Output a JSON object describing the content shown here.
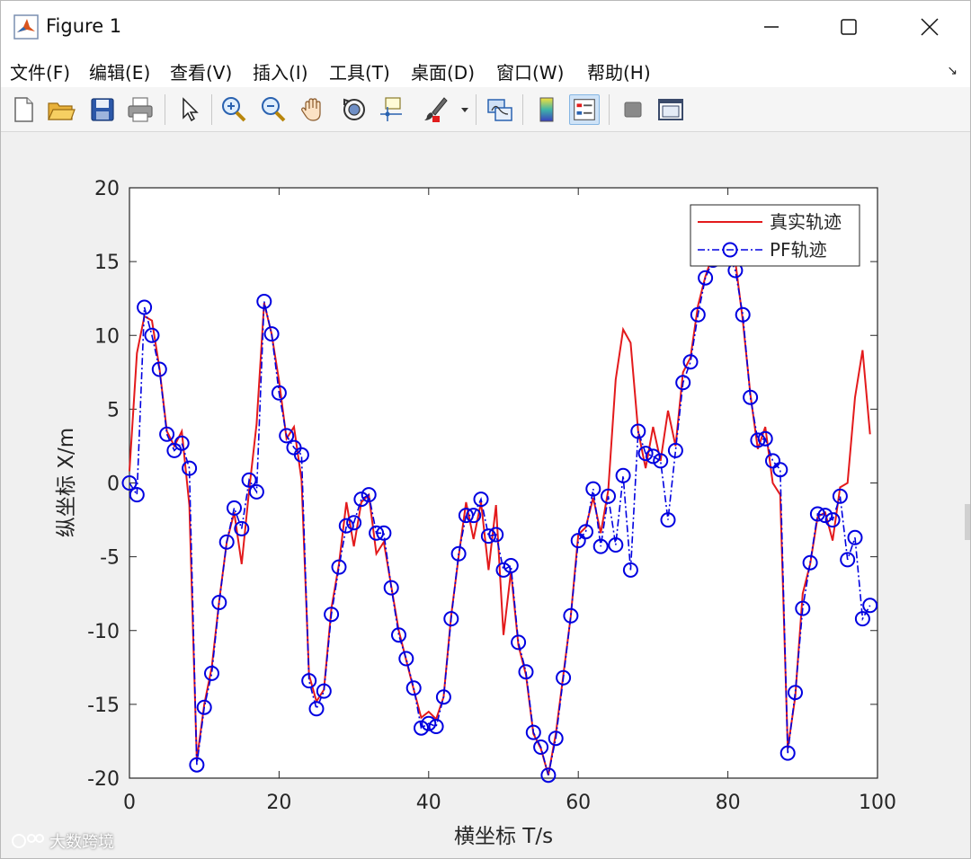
{
  "window": {
    "title": "Figure 1",
    "controls": {
      "minimize": "—",
      "maximize": "☐",
      "close": "✕"
    }
  },
  "menu": {
    "items": [
      "文件(F)",
      "编辑(E)",
      "查看(V)",
      "插入(I)",
      "工具(T)",
      "桌面(D)",
      "窗口(W)",
      "帮助(H)"
    ],
    "overflow_icon": "↘"
  },
  "toolbar": {
    "icons": [
      "new-figure-icon",
      "open-file-icon",
      "save-icon",
      "print-icon",
      "pointer-icon",
      "zoom-in-icon",
      "zoom-out-icon",
      "pan-hand-icon",
      "rotate-3d-icon",
      "data-cursor-icon",
      "brush-icon",
      "brush-dropdown-icon",
      "link-plot-icon",
      "colorbar-icon",
      "legend-icon",
      "hide-plot-tools-icon",
      "show-plot-tools-icon"
    ]
  },
  "watermark": {
    "text": "大数跨境"
  },
  "chart_data": {
    "type": "line",
    "title": "",
    "xlabel": "横坐标 T/s",
    "ylabel": "纵坐标 X/m",
    "xlim": [
      0,
      100
    ],
    "ylim": [
      -20,
      20
    ],
    "xticks": [
      0,
      20,
      40,
      60,
      80,
      100
    ],
    "yticks": [
      -20,
      -15,
      -10,
      -5,
      0,
      5,
      10,
      15,
      20
    ],
    "grid": false,
    "legend_position": "top-right",
    "series": [
      {
        "name": "真实轨迹",
        "color": "#e31a1c",
        "style": "solid",
        "marker": "none",
        "x": [
          0,
          1,
          2,
          3,
          4,
          5,
          6,
          7,
          8,
          9,
          10,
          11,
          12,
          13,
          14,
          15,
          16,
          17,
          18,
          19,
          20,
          21,
          22,
          23,
          24,
          25,
          26,
          27,
          28,
          29,
          30,
          31,
          32,
          33,
          34,
          35,
          36,
          37,
          38,
          39,
          40,
          41,
          42,
          43,
          44,
          45,
          46,
          47,
          48,
          49,
          50,
          51,
          52,
          53,
          54,
          55,
          56,
          57,
          58,
          59,
          60,
          61,
          62,
          63,
          64,
          65,
          66,
          67,
          68,
          69,
          70,
          71,
          72,
          73,
          74,
          75,
          76,
          77,
          78,
          79,
          80,
          81,
          82,
          83,
          84,
          85,
          86,
          87,
          88,
          89,
          90,
          91,
          92,
          93,
          94,
          95,
          96,
          97,
          98,
          99
        ],
        "y": [
          0.8,
          8.8,
          11.3,
          11.0,
          7.8,
          3.5,
          2.5,
          3.5,
          -1.5,
          -18.8,
          -15.0,
          -12.5,
          -8.0,
          -4.0,
          -2.0,
          -5.5,
          -0.5,
          4.0,
          12.2,
          10.1,
          6.9,
          3.0,
          3.8,
          0.2,
          -13.0,
          -14.8,
          -14.0,
          -8.5,
          -5.5,
          -1.3,
          -4.3,
          -1.3,
          -0.8,
          -4.8,
          -4.0,
          -7.0,
          -10.0,
          -12.0,
          -14.0,
          -15.9,
          -15.5,
          -16.0,
          -14.5,
          -9.0,
          -5.0,
          -1.3,
          -3.8,
          -1.3,
          -5.9,
          -1.5,
          -10.3,
          -6.0,
          -11.0,
          -13.0,
          -17.0,
          -18.0,
          -19.8,
          -17.0,
          -13.0,
          -9.0,
          -3.5,
          -3.0,
          -1.0,
          -3.4,
          -0.5,
          7.0,
          10.4,
          9.5,
          3.5,
          1.0,
          3.8,
          1.5,
          4.9,
          2.5,
          7.5,
          8.5,
          12.0,
          14.0,
          15.5,
          16.3,
          15.8,
          15.0,
          11.0,
          6.0,
          2.3,
          3.8,
          0.0,
          -0.8,
          -18.0,
          -14.5,
          -7.5,
          -5.5,
          -2.3,
          -2.0,
          -3.9,
          -0.3,
          0.0,
          5.8,
          9.0,
          3.3
        ]
      },
      {
        "name": "PF轨迹",
        "color": "#0000e0",
        "style": "dash-dot",
        "marker": "circle",
        "x": [
          0,
          1,
          2,
          3,
          4,
          5,
          6,
          7,
          8,
          9,
          10,
          11,
          12,
          13,
          14,
          15,
          16,
          17,
          18,
          19,
          20,
          21,
          22,
          23,
          24,
          25,
          26,
          27,
          28,
          29,
          30,
          31,
          32,
          33,
          34,
          35,
          36,
          37,
          38,
          39,
          40,
          41,
          42,
          43,
          44,
          45,
          46,
          47,
          48,
          49,
          50,
          51,
          52,
          53,
          54,
          55,
          56,
          57,
          58,
          59,
          60,
          61,
          62,
          63,
          64,
          65,
          66,
          67,
          68,
          69,
          70,
          71,
          72,
          73,
          74,
          75,
          76,
          77,
          78,
          79,
          80,
          81,
          82,
          83,
          84,
          85,
          86,
          87,
          88,
          89,
          90,
          91,
          92,
          93,
          94,
          95,
          96,
          97,
          98,
          99
        ],
        "y": [
          0.0,
          -0.8,
          11.9,
          10.0,
          7.7,
          3.3,
          2.2,
          2.7,
          1.0,
          -19.1,
          -15.2,
          -12.9,
          -8.1,
          -4.0,
          -1.7,
          -3.1,
          0.2,
          -0.6,
          12.3,
          10.1,
          6.1,
          3.2,
          2.4,
          1.9,
          -13.4,
          -15.3,
          -14.1,
          -8.9,
          -5.7,
          -2.9,
          -2.7,
          -1.1,
          -0.8,
          -3.4,
          -3.4,
          -7.1,
          -10.3,
          -11.9,
          -13.9,
          -16.6,
          -16.3,
          -16.5,
          -14.5,
          -9.2,
          -4.8,
          -2.2,
          -2.2,
          -1.1,
          -3.6,
          -3.5,
          -5.9,
          -5.6,
          -10.8,
          -12.8,
          -16.9,
          -17.9,
          -19.8,
          -17.3,
          -13.2,
          -9.0,
          -3.9,
          -3.3,
          -0.4,
          -4.3,
          -0.9,
          -4.2,
          0.5,
          -5.9,
          3.5,
          2.0,
          1.8,
          1.5,
          -2.5,
          2.2,
          6.8,
          8.2,
          11.4,
          13.9,
          15.1,
          15.7,
          15.5,
          14.4,
          11.4,
          5.8,
          2.9,
          3.0,
          1.5,
          0.9,
          -18.3,
          -14.2,
          -8.5,
          -5.4,
          -2.1,
          -2.2,
          -2.5,
          -0.9,
          -5.2,
          -3.7,
          -9.2,
          -8.3
        ]
      }
    ]
  }
}
